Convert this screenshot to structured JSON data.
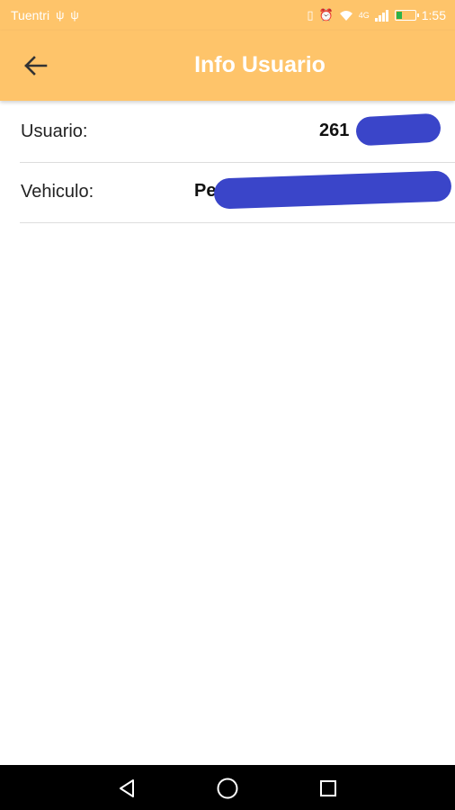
{
  "status_bar": {
    "carrier": "Tuentri",
    "usb_icon": "usb-icon",
    "time": "1:55",
    "network": "4G",
    "battery_level": 0.3
  },
  "app_bar": {
    "title": "Info Usuario",
    "back_icon": "arrow-left-icon",
    "background_color": "#fec46a"
  },
  "rows": [
    {
      "label": "Usuario:",
      "value": "261"
    },
    {
      "label": "Vehiculo:",
      "value": "Pe"
    }
  ],
  "nav_bar": {
    "back_icon": "triangle-back-icon",
    "home_icon": "circle-home-icon",
    "recents_icon": "square-recents-icon"
  },
  "colors": {
    "accent": "#fec46a",
    "redaction": "#3a45c9",
    "battery": "#2bb24a"
  }
}
